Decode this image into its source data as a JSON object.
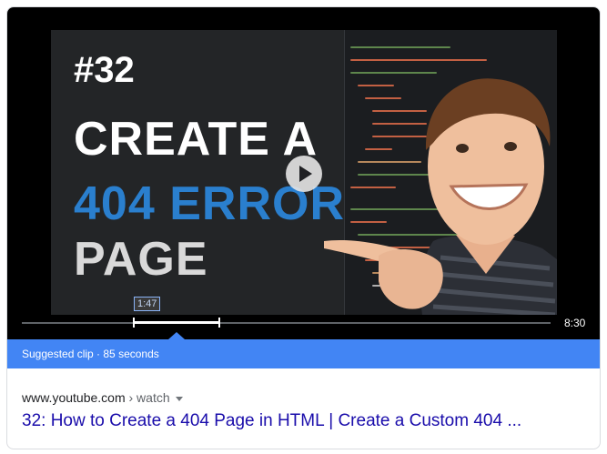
{
  "video": {
    "thumbnail": {
      "episode": "#32",
      "line1": "CREATE A",
      "line2": "404 ERROR",
      "line3": "PAGE"
    },
    "clip_start_label": "1:47",
    "duration": "8:30",
    "clip_start_fraction": 0.21,
    "clip_end_fraction": 0.37
  },
  "suggested_clip": {
    "label": "Suggested clip · 85 seconds"
  },
  "result": {
    "domain": "www.youtube.com",
    "crumb": " › watch",
    "title": "32: How to Create a 404 Page in HTML | Create a Custom 404 ..."
  },
  "colors": {
    "accent": "#4285f4",
    "link": "#1a0dab",
    "error_text": "#2a7fce"
  },
  "icons": {
    "play": "play-icon",
    "dropdown": "caret-down-icon"
  }
}
